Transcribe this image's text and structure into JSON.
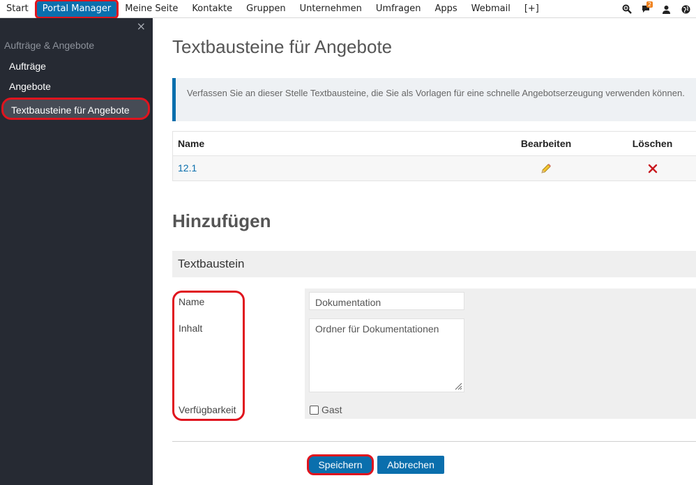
{
  "topnav": {
    "items": [
      {
        "label": "Start"
      },
      {
        "label": "Portal Manager",
        "active": true
      },
      {
        "label": "Meine Seite"
      },
      {
        "label": "Kontakte"
      },
      {
        "label": "Gruppen"
      },
      {
        "label": "Unternehmen"
      },
      {
        "label": "Umfragen"
      },
      {
        "label": "Apps"
      },
      {
        "label": "Webmail"
      },
      {
        "label": "[+]"
      }
    ],
    "icons": [
      "search-zoom-icon",
      "chat-icon",
      "user-icon",
      "globe-icon"
    ],
    "chat_badge": "2"
  },
  "sidebar": {
    "close": "×",
    "section_title": "Aufträge & Angebote",
    "items": [
      {
        "label": "Aufträge"
      },
      {
        "label": "Angebote"
      },
      {
        "label": "Textbausteine für Angebote",
        "active": true
      }
    ]
  },
  "main": {
    "title": "Textbausteine für Angebote",
    "info_text": "Verfassen Sie an dieser Stelle Textbausteine, die Sie als Vorlagen für eine schnelle Angebotserzeugung verwenden können.",
    "table": {
      "headers": {
        "name": "Name",
        "edit": "Bearbeiten",
        "delete": "Löschen"
      },
      "rows": [
        {
          "name": "12.1",
          "edit_icon": "pencil-icon",
          "delete_icon": "delete-x-icon"
        }
      ]
    },
    "add_title": "Hinzufügen",
    "section_bar": "Textbaustein",
    "form": {
      "name_label": "Name",
      "content_label": "Inhalt",
      "availability_label": "Verfügbarkeit",
      "name_value": "Dokumentation",
      "content_value": "Ordner für Dokumentationen",
      "checkbox_label": "Gast",
      "checkbox_checked": false
    },
    "buttons": {
      "save": "Speichern",
      "cancel": "Abbrechen"
    }
  },
  "colors": {
    "accent": "#0a6fad",
    "sidebar_bg": "#262a33",
    "highlight_red": "#e0141e",
    "badge_orange": "#f0821e"
  }
}
